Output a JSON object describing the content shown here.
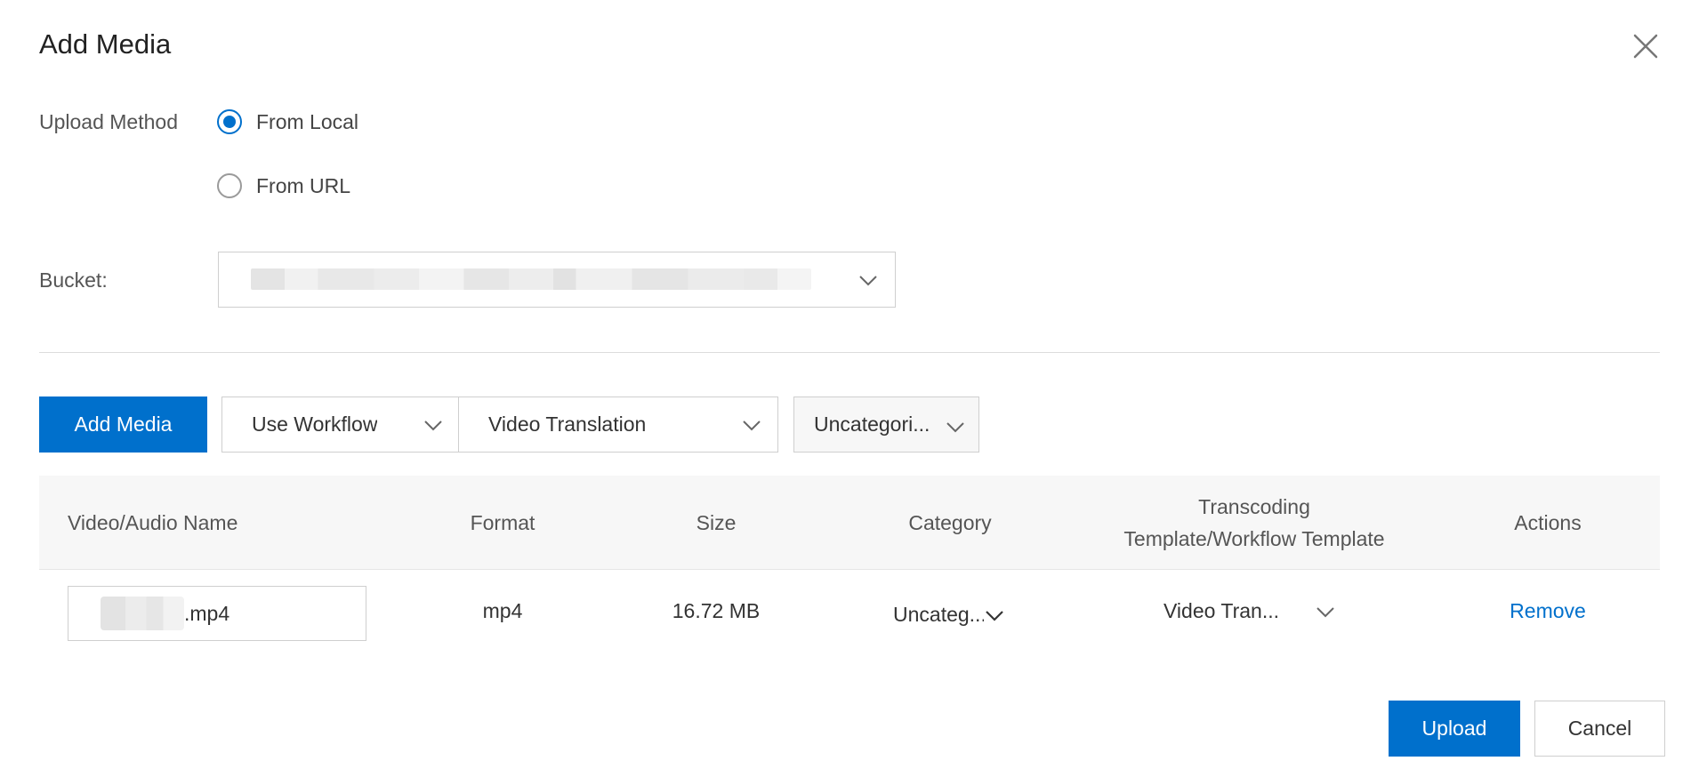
{
  "dialog": {
    "title": "Add Media",
    "close_icon": "close-icon"
  },
  "upload": {
    "label": "Upload Method",
    "options": [
      {
        "label": "From Local",
        "checked": true
      },
      {
        "label": "From URL",
        "checked": false
      }
    ]
  },
  "bucket": {
    "label": "Bucket:"
  },
  "toolbar": {
    "add_media_label": "Add Media",
    "workflow_mode": "Use Workflow",
    "workflow_template": "Video Translation",
    "category": "Uncategori..."
  },
  "table": {
    "headers": {
      "name": "Video/Audio Name",
      "format": "Format",
      "size": "Size",
      "category": "Category",
      "template_line1": "Transcoding",
      "template_line2": "Template/Workflow Template",
      "actions": "Actions"
    },
    "rows": [
      {
        "name_ext": ".mp4",
        "format": "mp4",
        "size": "16.72 MB",
        "category": "Uncateg...",
        "template": "Video Tran...",
        "action": "Remove"
      }
    ]
  },
  "footer": {
    "upload_label": "Upload",
    "cancel_label": "Cancel"
  },
  "colors": {
    "primary": "#0070cc",
    "border": "#cfcfcf",
    "header_bg": "#f7f7f7"
  }
}
